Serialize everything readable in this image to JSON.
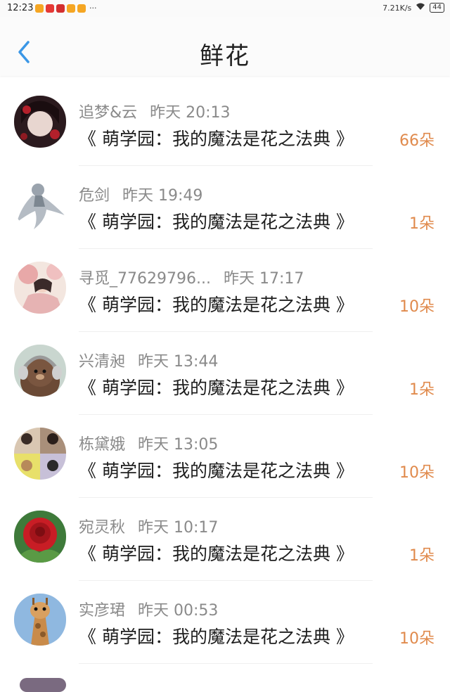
{
  "status_bar": {
    "time": "12:23",
    "dots": "···",
    "net_speed": "7.21K/s",
    "battery": "44"
  },
  "header": {
    "title": "鲜花"
  },
  "colors": {
    "count_color": "#e08a4c",
    "back_color": "#3b97e6"
  },
  "items": [
    {
      "name": "追梦&云",
      "time": "昨天 20:13",
      "book": "《 萌学园：我的魔法是花之法典 》",
      "count": "66朵"
    },
    {
      "name": "危剑",
      "time": "昨天 19:49",
      "book": "《 萌学园：我的魔法是花之法典 》",
      "count": "1朵"
    },
    {
      "name": "寻觅_77629796...",
      "time": "昨天 17:17",
      "book": "《 萌学园：我的魔法是花之法典 》",
      "count": "10朵"
    },
    {
      "name": "兴清昶",
      "time": "昨天 13:44",
      "book": "《 萌学园：我的魔法是花之法典 》",
      "count": "1朵"
    },
    {
      "name": "栋黛娥",
      "time": "昨天 13:05",
      "book": "《 萌学园：我的魔法是花之法典 》",
      "count": "10朵"
    },
    {
      "name": "宛灵秋",
      "time": "昨天 10:17",
      "book": "《 萌学园：我的魔法是花之法典 》",
      "count": "1朵"
    },
    {
      "name": "实彦珺",
      "time": "昨天 00:53",
      "book": "《 萌学园：我的魔法是花之法典 》",
      "count": "10朵"
    }
  ]
}
